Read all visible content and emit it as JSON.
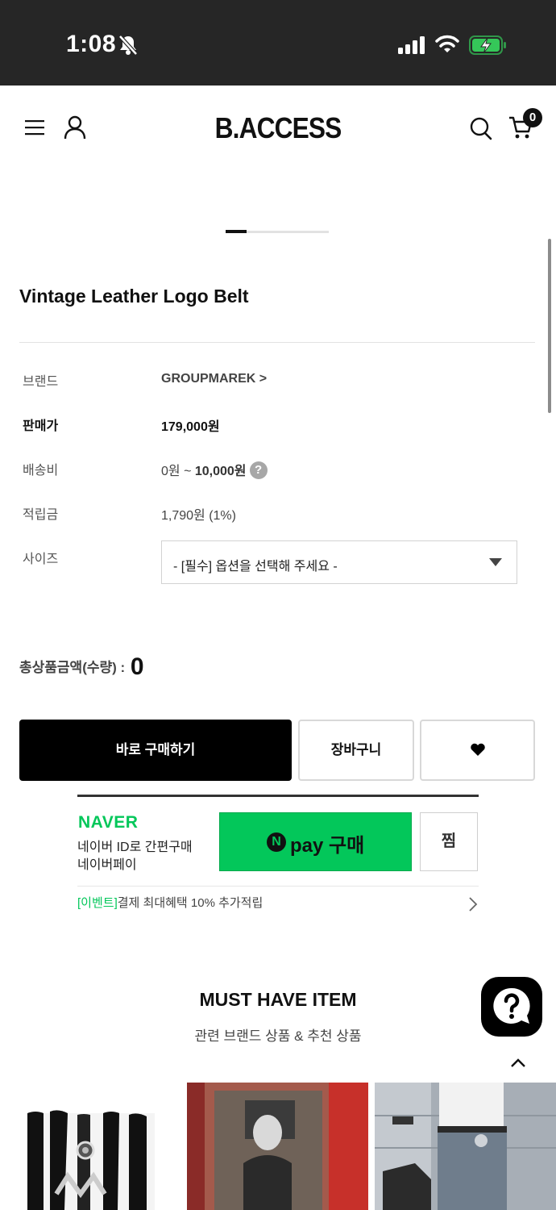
{
  "status_bar": {
    "time": "1:08"
  },
  "header": {
    "logo": "B.ACCESS",
    "cart_count": "0"
  },
  "product": {
    "title": "Vintage Leather Logo Belt",
    "info": {
      "brand_label": "브랜드",
      "brand_value": "GROUPMAREK >",
      "price_label": "판매가",
      "price_value": "179,000원",
      "shipping_label": "배송비",
      "shipping_min": "0원 ~ ",
      "shipping_max": "10,000원",
      "points_label": "적립금",
      "points_value": "1,790원 (1%)",
      "size_label": "사이즈",
      "size_placeholder": "- [필수] 옵션을 선택해 주세요 -"
    },
    "total_label": "총상품금액(수량) :",
    "total_value": "0"
  },
  "actions": {
    "buy_label": "바로 구매하기",
    "cart_label": "장바구니"
  },
  "naver": {
    "logo": "NAVER",
    "desc_line1": "네이버 ID로 간편구매",
    "desc_line2": "네이버페이",
    "npay_n": "N",
    "npay_label": "pay 구매",
    "jjim_label": "찜",
    "event_tag": "[이벤트]",
    "event_text": "결제 최대혜택 10% 추가적립"
  },
  "recommend": {
    "title": "MUST HAVE ITEM",
    "subtitle": "관련 브랜드 상품 & 추천 상품"
  },
  "icons": {
    "menu": "menu-icon",
    "user": "user-icon",
    "search": "search-icon",
    "cart": "cart-icon",
    "heart": "heart-icon",
    "help": "help-icon",
    "chat": "chat-help-icon",
    "scroll_up": "chevron-up-icon",
    "scroll_down": "chevron-down-icon"
  },
  "colors": {
    "naver_green": "#03c75a",
    "primary_black": "#000000",
    "status_bar": "#262626",
    "battery_green": "#35c759"
  }
}
